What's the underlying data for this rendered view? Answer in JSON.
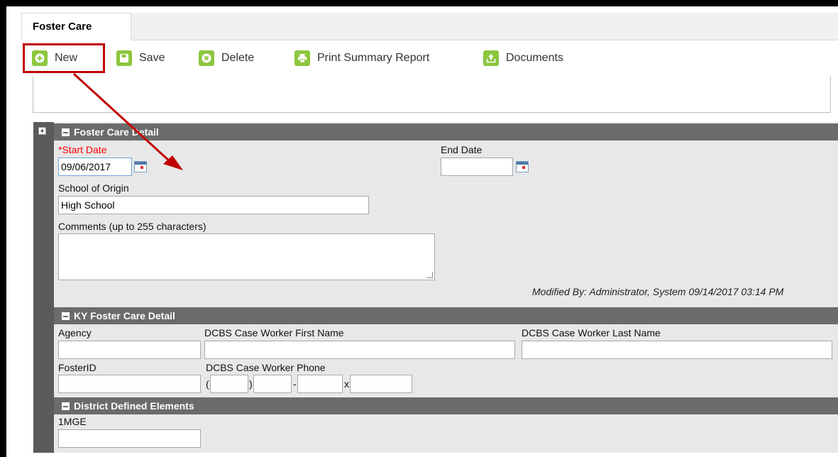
{
  "tab": {
    "label": "Foster Care"
  },
  "toolbar": {
    "new_label": "New",
    "save_label": "Save",
    "delete_label": "Delete",
    "print_label": "Print Summary Report",
    "documents_label": "Documents"
  },
  "foster_care_detail": {
    "header": "Foster Care Detail",
    "start_date_label": "*Start Date",
    "start_date_value": "09/06/2017",
    "end_date_label": "End Date",
    "end_date_value": "",
    "school_of_origin_label": "School of Origin",
    "school_of_origin_value": "High School",
    "comments_label": "Comments (up to 255 characters)",
    "comments_value": "",
    "modified_by": "Modified By: Administrator, System 09/14/2017 03:14 PM"
  },
  "ky_foster_care_detail": {
    "header": "KY Foster Care Detail",
    "agency_label": "Agency",
    "case_worker_first_label": "DCBS Case Worker First Name",
    "case_worker_last_label": "DCBS Case Worker Last Name",
    "foster_id_label": "FosterID",
    "case_worker_phone_label": "DCBS Case Worker Phone",
    "phone_open_paren": "(",
    "phone_close_paren": ")",
    "phone_dash": "-",
    "phone_ext": "x"
  },
  "district_defined": {
    "header": "District Defined Elements",
    "field_label": "1MGE"
  },
  "colors": {
    "accent_green": "#8dc63f",
    "highlight_red": "#c00000",
    "section_header": "#6b6b6b",
    "required_label": "#ff0000"
  }
}
